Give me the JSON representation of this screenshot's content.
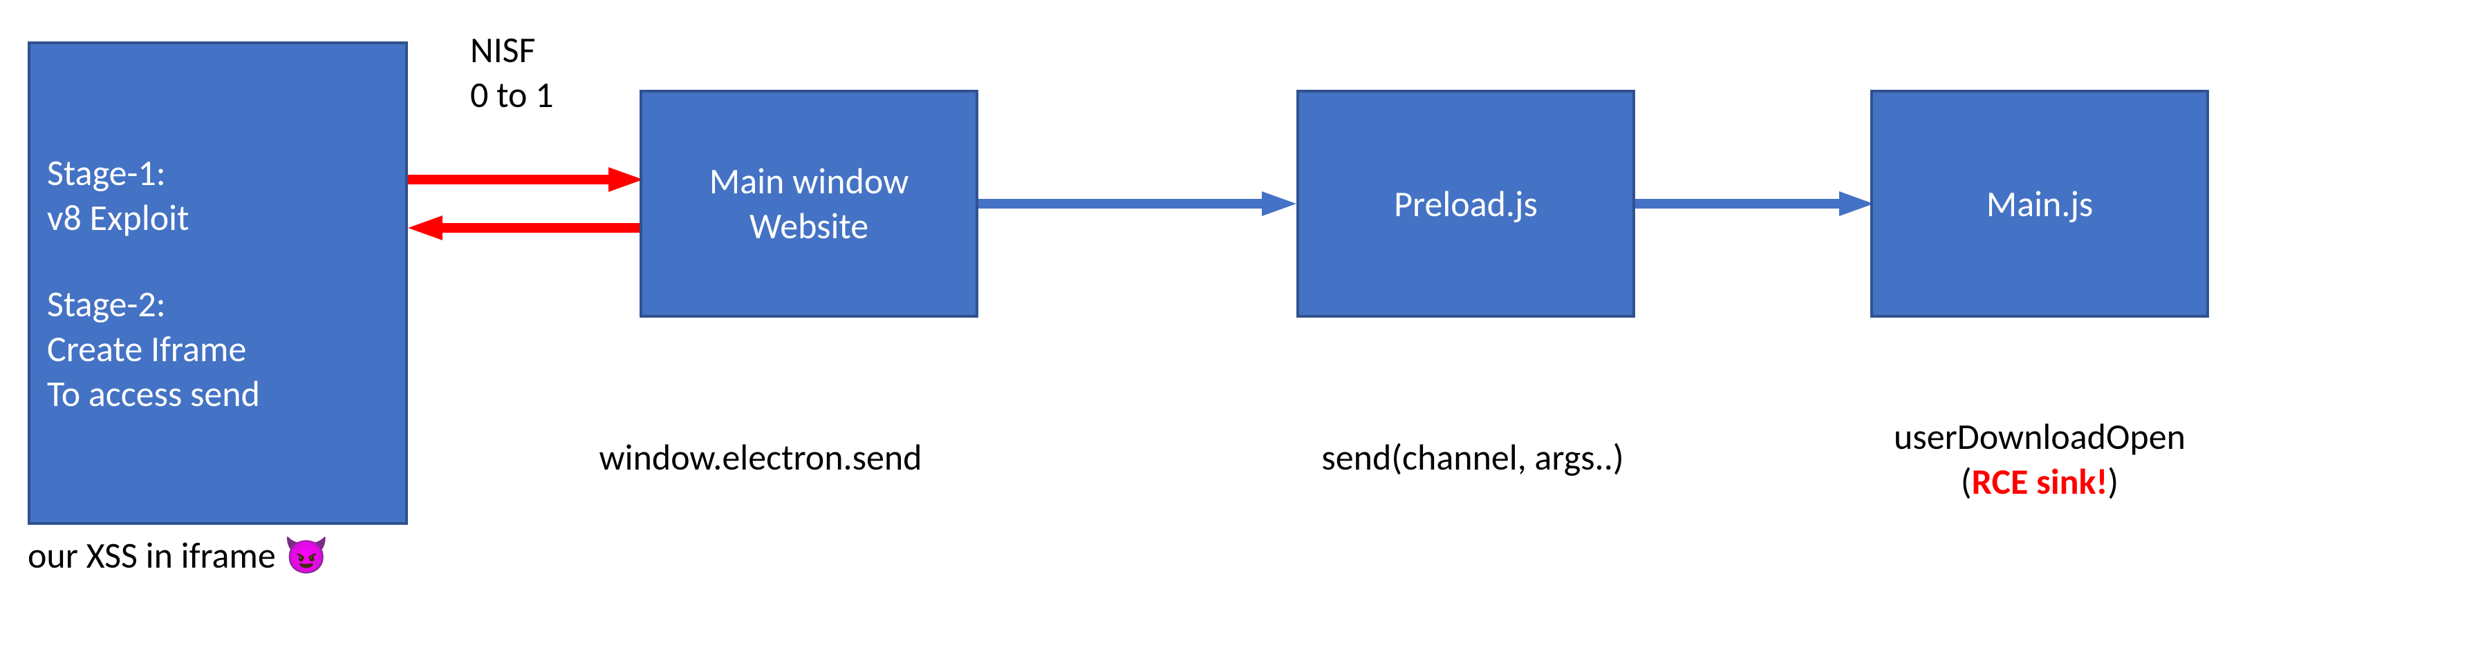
{
  "boxes": {
    "stage": {
      "line1": "Stage-1:",
      "line2": " v8 Exploit",
      "spacer": " ",
      "line3": "Stage-2:",
      "line4": "Create Iframe",
      "line5": "To access send"
    },
    "mainWindow": {
      "line1": "Main window",
      "line2": "Website"
    },
    "preload": {
      "text": "Preload.js"
    },
    "mainjs": {
      "text": "Main.js"
    }
  },
  "labels": {
    "nisf": {
      "line1": "NISF",
      "line2": "0 to 1"
    },
    "xss": "our XSS in iframe 😈",
    "electronSend": "window.electron.send",
    "sendChannel": "send(channel, args..)",
    "userDownload": {
      "line1": "userDownloadOpen",
      "paren_open": "(",
      "rce": "RCE sink!",
      "paren_close": ")"
    }
  },
  "colors": {
    "boxFill": "#4472C4",
    "boxBorder": "#2F528F",
    "arrowBlue": "#4472C4",
    "arrowRed": "#FF0000"
  }
}
